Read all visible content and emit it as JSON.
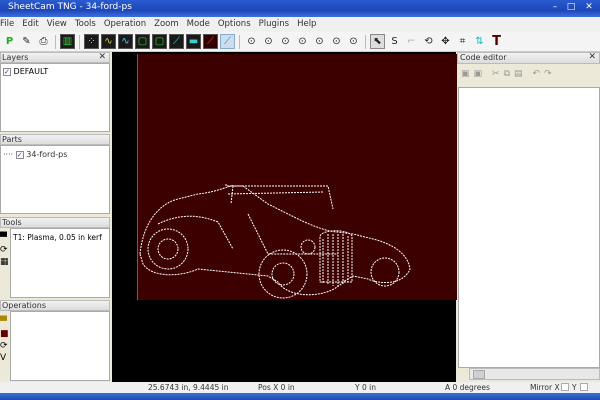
{
  "window": {
    "title": "SheetCam TNG - 34-ford-ps"
  },
  "menu": [
    "File",
    "Edit",
    "View",
    "Tools",
    "Operation",
    "Zoom",
    "Mode",
    "Options",
    "Plugins",
    "Help"
  ],
  "panels": {
    "layers": {
      "title": "Layers",
      "items": [
        {
          "label": "DEFAULT",
          "checked": true
        }
      ]
    },
    "parts": {
      "title": "Parts",
      "items": [
        {
          "label": "34-ford-ps",
          "checked": true
        }
      ]
    },
    "tools": {
      "title": "Tools",
      "items": [
        {
          "label": "T1: Plasma, 0.05 in kerf"
        }
      ]
    },
    "operations": {
      "title": "Operations",
      "items": []
    }
  },
  "code_editor": {
    "title": "Code editor"
  },
  "status": {
    "coords": "25.6743 in, 9.4445 in",
    "pos_x": "Pos X 0 in",
    "y": "Y 0 in",
    "angle": "A 0 degrees",
    "mirror_x": "Mirror X",
    "mirror_y": "Y"
  },
  "colors": {
    "sheet": "#3d0000",
    "canvas": "#000000",
    "titlebar": "#2a5bd0"
  }
}
